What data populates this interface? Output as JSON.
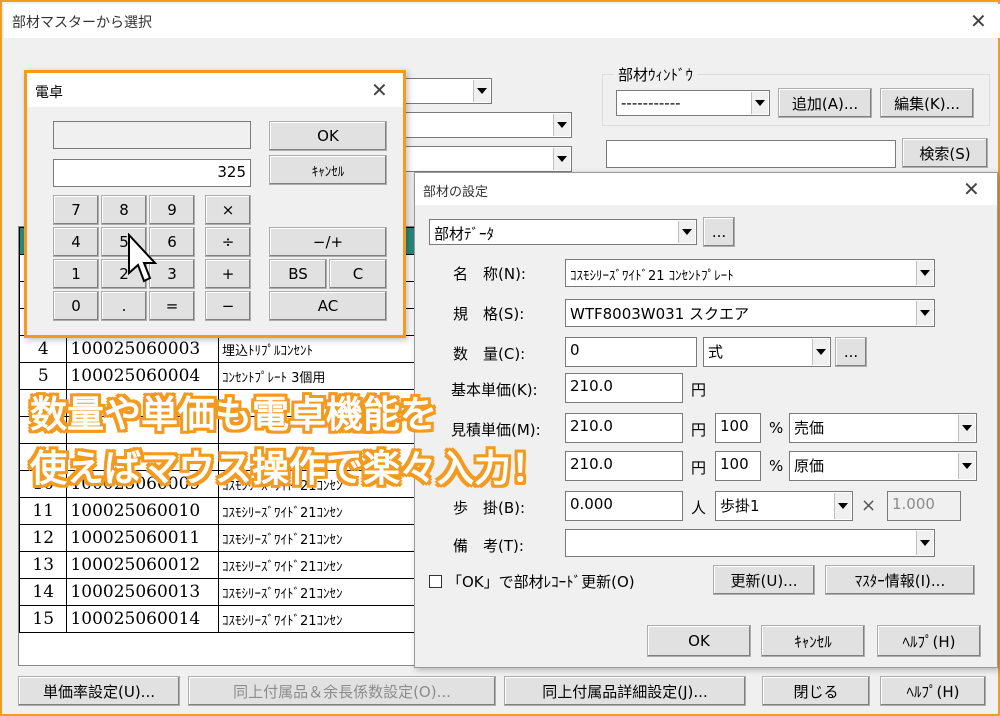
{
  "main": {
    "title": "部材マスターから選択",
    "group_window": "部材ｳｨﾝﾄﾞｳ",
    "window_combo": "-----------",
    "add_button": "追加(A)...",
    "edit_button": "編集(K)...",
    "search_button": "検索(S)",
    "bottom_buttons": [
      "単価率設定(U)...",
      "同上付属品＆余長係数設定(O)...",
      "同上付属品詳細設定(J)...",
      "閉じる",
      "ﾍﾙﾌﾟ(H)"
    ]
  },
  "table": {
    "rows": [
      {
        "no": "",
        "code": "",
        "name": ""
      },
      {
        "no": "",
        "code": "",
        "name": ""
      },
      {
        "no": "",
        "code": "",
        "name": ""
      },
      {
        "no": "4",
        "code": "100025060003",
        "name": "埋込ﾄﾘﾌﾟﾙｺﾝｾﾝﾄ"
      },
      {
        "no": "5",
        "code": "100025060004",
        "name": "ｺﾝｾﾝﾄﾌﾟﾚｰﾄ 3個用"
      },
      {
        "no": "",
        "code": "",
        "name": ""
      },
      {
        "no": "",
        "code": "",
        "name": ""
      },
      {
        "no": "",
        "code": "",
        "name": ""
      },
      {
        "no": "10",
        "code": "100025060009",
        "name": "ｺｽﾓｼﾘｰｽﾞﾜｲﾄﾞ21ｺﾝｾﾝ"
      },
      {
        "no": "11",
        "code": "100025060010",
        "name": "ｺｽﾓｼﾘｰｽﾞﾜｲﾄﾞ21ｺﾝｾﾝ"
      },
      {
        "no": "12",
        "code": "100025060011",
        "name": "ｺｽﾓｼﾘｰｽﾞﾜｲﾄﾞ21ｺﾝｾﾝ"
      },
      {
        "no": "13",
        "code": "100025060012",
        "name": "ｺｽﾓｼﾘｰｽﾞﾜｲﾄﾞ21ｺﾝｾﾝ"
      },
      {
        "no": "14",
        "code": "100025060013",
        "name": "ｺｽﾓｼﾘｰｽﾞﾜｲﾄﾞ21ｺﾝｾﾝ"
      },
      {
        "no": "15",
        "code": "100025060014",
        "name": "ｺｽﾓｼﾘｰｽﾞﾜｲﾄﾞ21ｺﾝｾﾝ"
      }
    ]
  },
  "calc": {
    "title": "電卓",
    "display": "325",
    "ok": "OK",
    "cancel": "ｷｬﾝｾﾙ",
    "keys": [
      "7",
      "8",
      "9",
      "4",
      "5",
      "6",
      "1",
      "2",
      "3",
      "0",
      ".",
      "="
    ],
    "ops": [
      "×",
      "÷",
      "+",
      "−"
    ],
    "plusminus": "−/+",
    "bs": "BS",
    "c": "C",
    "ac": "AC"
  },
  "settings": {
    "title": "部材の設定",
    "data_combo": "部材ﾃﾞｰﾀ",
    "ellipsis": "...",
    "name_label": "名　称(N):",
    "name_value": "ｺｽﾓｼﾘｰｽﾞﾜｲﾄﾞ21 ｺﾝｾﾝﾄﾌﾟﾚｰﾄ",
    "spec_label": "規　格(S):",
    "spec_value": "WTF8003W031 スクエア",
    "qty_label": "数　量(C):",
    "qty_value": "0",
    "unit_value": "式",
    "base_label": "基本単価(K):",
    "base_value": "210.0",
    "yen": "円",
    "est_label": "見積単価(M):",
    "est_value": "210.0",
    "est_pct": "100",
    "pct": "%",
    "est_type": "売価",
    "cost_value": "210.0",
    "cost_pct": "100",
    "cost_type": "原価",
    "step_label": "歩　掛(B):",
    "step_value": "0.000",
    "person": "人",
    "step_combo": "歩掛1",
    "times": "×",
    "step_factor": "1.000",
    "note_label": "備　考(T):",
    "note_value": "",
    "checkbox_label": "「OK」で部材ﾚｺｰﾄﾞ更新(O)",
    "update_button": "更新(U)...",
    "master_button": "ﾏｽﾀｰ情報(I)...",
    "ok_button": "OK",
    "cancel_button": "ｷｬﾝｾﾙ",
    "help_button": "ﾍﾙﾌﾟ(H)"
  },
  "overlay": {
    "line1": "数量や単価も電卓機能を",
    "line2": "使えばマウス操作で楽々入力！"
  },
  "colors": {
    "accent": "#f39a1f",
    "header": "#2a8a7e"
  }
}
